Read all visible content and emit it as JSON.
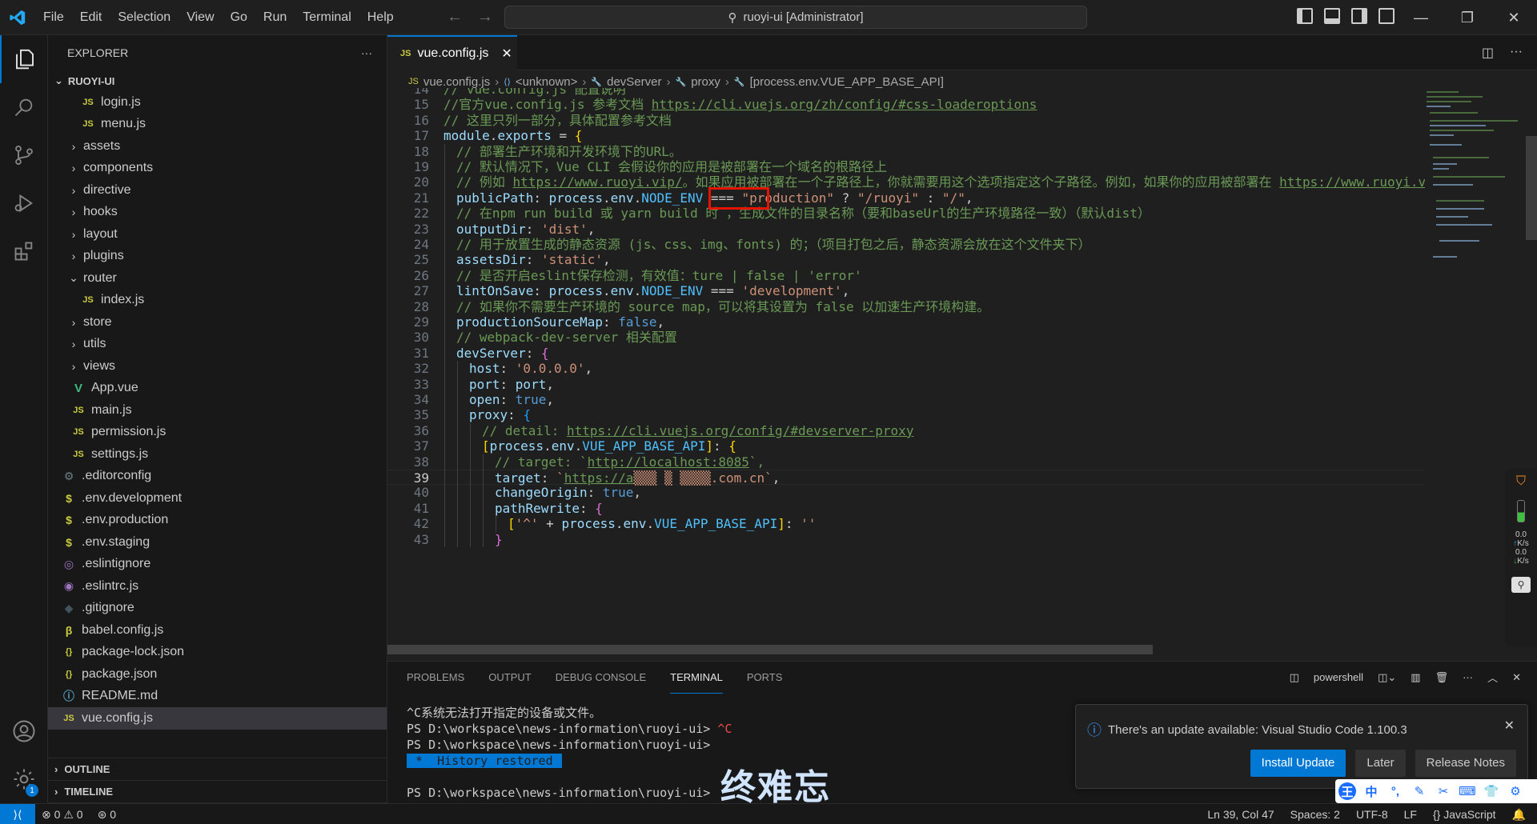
{
  "titlebar": {
    "menu": [
      "File",
      "Edit",
      "Selection",
      "View",
      "Go",
      "Run",
      "Terminal",
      "Help"
    ],
    "command_center": "ruoyi-ui [Administrator]"
  },
  "sidebar": {
    "header": "EXPLORER",
    "more": "···",
    "root": "RUOYI-UI",
    "items": [
      {
        "label": "login.js",
        "type": "file",
        "icon": "JS",
        "depth": 3
      },
      {
        "label": "menu.js",
        "type": "file",
        "icon": "JS",
        "depth": 3
      },
      {
        "label": "assets",
        "type": "folder",
        "depth": 2
      },
      {
        "label": "components",
        "type": "folder",
        "depth": 2
      },
      {
        "label": "directive",
        "type": "folder",
        "depth": 2
      },
      {
        "label": "hooks",
        "type": "folder",
        "depth": 2
      },
      {
        "label": "layout",
        "type": "folder",
        "depth": 2
      },
      {
        "label": "plugins",
        "type": "folder",
        "depth": 2
      },
      {
        "label": "router",
        "type": "folder-open",
        "depth": 2
      },
      {
        "label": "index.js",
        "type": "file",
        "icon": "JS",
        "depth": 3
      },
      {
        "label": "store",
        "type": "folder",
        "depth": 2
      },
      {
        "label": "utils",
        "type": "folder",
        "depth": 2
      },
      {
        "label": "views",
        "type": "folder",
        "depth": 2
      },
      {
        "label": "App.vue",
        "type": "file",
        "icon": "V",
        "depth": 2
      },
      {
        "label": "main.js",
        "type": "file",
        "icon": "JS",
        "depth": 2
      },
      {
        "label": "permission.js",
        "type": "file",
        "icon": "JS",
        "depth": 2
      },
      {
        "label": "settings.js",
        "type": "file",
        "icon": "JS",
        "depth": 2
      },
      {
        "label": ".editorconfig",
        "type": "file",
        "icon": "⚙",
        "depth": 1
      },
      {
        "label": ".env.development",
        "type": "file",
        "icon": "$",
        "depth": 1
      },
      {
        "label": ".env.production",
        "type": "file",
        "icon": "$",
        "depth": 1
      },
      {
        "label": ".env.staging",
        "type": "file",
        "icon": "$",
        "depth": 1
      },
      {
        "label": ".eslintignore",
        "type": "file",
        "icon": "◎",
        "depth": 1
      },
      {
        "label": ".eslintrc.js",
        "type": "file",
        "icon": "◉",
        "depth": 1
      },
      {
        "label": ".gitignore",
        "type": "file",
        "icon": "◆",
        "depth": 1
      },
      {
        "label": "babel.config.js",
        "type": "file",
        "icon": "β",
        "depth": 1
      },
      {
        "label": "package-lock.json",
        "type": "file",
        "icon": "{}",
        "depth": 1
      },
      {
        "label": "package.json",
        "type": "file",
        "icon": "{}",
        "depth": 1
      },
      {
        "label": "README.md",
        "type": "file",
        "icon": "ⓘ",
        "depth": 1
      },
      {
        "label": "vue.config.js",
        "type": "file",
        "icon": "JS",
        "depth": 1,
        "selected": true
      }
    ],
    "outline": "OUTLINE",
    "timeline": "TIMELINE"
  },
  "editor": {
    "tab_label": "vue.config.js",
    "tab_icon": "JS",
    "breadcrumb": [
      "vue.config.js",
      "<unknown>",
      "devServer",
      "proxy",
      "[process.env.VUE_APP_BASE_API]"
    ],
    "current_line": 39,
    "lines": [
      {
        "n": 14,
        "indent": 0,
        "parts": [
          [
            "c-com",
            "// vue.config.js 配置说明"
          ]
        ]
      },
      {
        "n": 15,
        "indent": 0,
        "parts": [
          [
            "c-com",
            "//官方vue.config.js 参考文档 "
          ],
          [
            "c-link",
            "https://cli.vuejs.org/zh/config/#css-loaderoptions"
          ]
        ]
      },
      {
        "n": 16,
        "indent": 0,
        "parts": [
          [
            "c-com",
            "// 这里只列一部分，具体配置参考文档"
          ]
        ]
      },
      {
        "n": 17,
        "indent": 0,
        "parts": [
          [
            "c-var",
            "module"
          ],
          [
            "c-p",
            "."
          ],
          [
            "c-var",
            "exports"
          ],
          [
            "c-p",
            " = "
          ],
          [
            "c-y",
            "{"
          ]
        ]
      },
      {
        "n": 18,
        "indent": 1,
        "parts": [
          [
            "c-com",
            "// 部署生产环境和开发环境下的URL。"
          ]
        ]
      },
      {
        "n": 19,
        "indent": 1,
        "parts": [
          [
            "c-com",
            "// 默认情况下，Vue CLI 会假设你的应用是被部署在一个域名的根路径上"
          ]
        ]
      },
      {
        "n": 20,
        "indent": 1,
        "parts": [
          [
            "c-com",
            "// 例如 "
          ],
          [
            "c-link",
            "https://www.ruoyi.vip/"
          ],
          [
            "c-com",
            "。如果应用被部署在一个子路径上，你就需要用这个选项指定这个子路径。例如，如果你的应用被部署在 "
          ],
          [
            "c-link",
            "https://www.ruoyi.vip/admin/"
          ]
        ]
      },
      {
        "n": 21,
        "indent": 1,
        "parts": [
          [
            "c-var",
            "publicPath"
          ],
          [
            "c-p",
            ": "
          ],
          [
            "c-var",
            "process"
          ],
          [
            "c-p",
            "."
          ],
          [
            "c-var",
            "env"
          ],
          [
            "c-p",
            "."
          ],
          [
            "c-const",
            "NODE_ENV"
          ],
          [
            "c-p",
            " === "
          ],
          [
            "c-str",
            "\"production\""
          ],
          [
            "c-p",
            " ? "
          ],
          [
            "c-str",
            "\"/ruoyi\""
          ],
          [
            "c-p",
            " : "
          ],
          [
            "c-str",
            "\"/\""
          ],
          [
            "c-p",
            ","
          ]
        ]
      },
      {
        "n": 22,
        "indent": 1,
        "parts": [
          [
            "c-com",
            "// 在npm run build 或 yarn build 时 ，生成文件的目录名称（要和baseUrl的生产环境路径一致）（默认dist）"
          ]
        ]
      },
      {
        "n": 23,
        "indent": 1,
        "parts": [
          [
            "c-var",
            "outputDir"
          ],
          [
            "c-p",
            ": "
          ],
          [
            "c-str",
            "'dist'"
          ],
          [
            "c-p",
            ","
          ]
        ]
      },
      {
        "n": 24,
        "indent": 1,
        "parts": [
          [
            "c-com",
            "// 用于放置生成的静态资源 (js、css、img、fonts) 的；（项目打包之后，静态资源会放在这个文件夹下）"
          ]
        ]
      },
      {
        "n": 25,
        "indent": 1,
        "parts": [
          [
            "c-var",
            "assetsDir"
          ],
          [
            "c-p",
            ": "
          ],
          [
            "c-str",
            "'static'"
          ],
          [
            "c-p",
            ","
          ]
        ]
      },
      {
        "n": 26,
        "indent": 1,
        "parts": [
          [
            "c-com",
            "// 是否开启eslint保存检测，有效值：ture | false | 'error'"
          ]
        ]
      },
      {
        "n": 27,
        "indent": 1,
        "parts": [
          [
            "c-var",
            "lintOnSave"
          ],
          [
            "c-p",
            ": "
          ],
          [
            "c-var",
            "process"
          ],
          [
            "c-p",
            "."
          ],
          [
            "c-var",
            "env"
          ],
          [
            "c-p",
            "."
          ],
          [
            "c-const",
            "NODE_ENV"
          ],
          [
            "c-p",
            " === "
          ],
          [
            "c-str",
            "'development'"
          ],
          [
            "c-p",
            ","
          ]
        ]
      },
      {
        "n": 28,
        "indent": 1,
        "parts": [
          [
            "c-com",
            "// 如果你不需要生产环境的 source map，可以将其设置为 false 以加速生产环境构建。"
          ]
        ]
      },
      {
        "n": 29,
        "indent": 1,
        "parts": [
          [
            "c-var",
            "productionSourceMap"
          ],
          [
            "c-p",
            ": "
          ],
          [
            "c-kw",
            "false"
          ],
          [
            "c-p",
            ","
          ]
        ]
      },
      {
        "n": 30,
        "indent": 1,
        "parts": [
          [
            "c-com",
            "// webpack-dev-server 相关配置"
          ]
        ]
      },
      {
        "n": 31,
        "indent": 1,
        "parts": [
          [
            "c-var",
            "devServer"
          ],
          [
            "c-p",
            ": "
          ],
          [
            "c-pk",
            "{"
          ]
        ]
      },
      {
        "n": 32,
        "indent": 2,
        "parts": [
          [
            "c-var",
            "host"
          ],
          [
            "c-p",
            ": "
          ],
          [
            "c-str",
            "'0.0.0.0'"
          ],
          [
            "c-p",
            ","
          ]
        ]
      },
      {
        "n": 33,
        "indent": 2,
        "parts": [
          [
            "c-var",
            "port"
          ],
          [
            "c-p",
            ": "
          ],
          [
            "c-var",
            "port"
          ],
          [
            "c-p",
            ","
          ]
        ]
      },
      {
        "n": 34,
        "indent": 2,
        "parts": [
          [
            "c-var",
            "open"
          ],
          [
            "c-p",
            ": "
          ],
          [
            "c-kw",
            "true"
          ],
          [
            "c-p",
            ","
          ]
        ]
      },
      {
        "n": 35,
        "indent": 2,
        "parts": [
          [
            "c-var",
            "proxy"
          ],
          [
            "c-p",
            ": "
          ],
          [
            "c-bl",
            "{"
          ]
        ]
      },
      {
        "n": 36,
        "indent": 3,
        "parts": [
          [
            "c-com",
            "// detail: "
          ],
          [
            "c-link",
            "https://cli.vuejs.org/config/#devserver-proxy"
          ]
        ]
      },
      {
        "n": 37,
        "indent": 3,
        "parts": [
          [
            "c-y",
            "["
          ],
          [
            "c-var",
            "process"
          ],
          [
            "c-p",
            "."
          ],
          [
            "c-var",
            "env"
          ],
          [
            "c-p",
            "."
          ],
          [
            "c-const",
            "VUE_APP_BASE_API"
          ],
          [
            "c-y",
            "]"
          ],
          [
            "c-p",
            ": "
          ],
          [
            "c-y",
            "{"
          ]
        ]
      },
      {
        "n": 38,
        "indent": 4,
        "parts": [
          [
            "c-com",
            "// target: `"
          ],
          [
            "c-link",
            "http://localhost:8085"
          ],
          [
            "c-com",
            "`,"
          ]
        ]
      },
      {
        "n": 39,
        "indent": 4,
        "parts": [
          [
            "c-var",
            "target"
          ],
          [
            "c-p",
            ": "
          ],
          [
            "c-str",
            "`"
          ],
          [
            "c-link",
            "https://a"
          ],
          [
            "c-str",
            "▒▒▒ ▒ ▒▒▒▒"
          ],
          [
            "c-str",
            ".com.cn`"
          ],
          [
            "c-p",
            ","
          ]
        ]
      },
      {
        "n": 40,
        "indent": 4,
        "parts": [
          [
            "c-var",
            "changeOrigin"
          ],
          [
            "c-p",
            ": "
          ],
          [
            "c-kw",
            "true"
          ],
          [
            "c-p",
            ","
          ]
        ]
      },
      {
        "n": 41,
        "indent": 4,
        "parts": [
          [
            "c-var",
            "pathRewrite"
          ],
          [
            "c-p",
            ": "
          ],
          [
            "c-pk",
            "{"
          ]
        ]
      },
      {
        "n": 42,
        "indent": 5,
        "parts": [
          [
            "c-y",
            "["
          ],
          [
            "c-str",
            "'^'"
          ],
          [
            "c-p",
            " + "
          ],
          [
            "c-var",
            "process"
          ],
          [
            "c-p",
            "."
          ],
          [
            "c-var",
            "env"
          ],
          [
            "c-p",
            "."
          ],
          [
            "c-const",
            "VUE_APP_BASE_API"
          ],
          [
            "c-y",
            "]"
          ],
          [
            "c-p",
            ": "
          ],
          [
            "c-str",
            "''"
          ]
        ]
      },
      {
        "n": 43,
        "indent": 4,
        "parts": [
          [
            "c-pk",
            "}"
          ]
        ]
      }
    ]
  },
  "panel": {
    "tabs": [
      "PROBLEMS",
      "OUTPUT",
      "DEBUG CONSOLE",
      "TERMINAL",
      "PORTS"
    ],
    "active_tab": "TERMINAL",
    "shell": "powershell",
    "terminal_lines": [
      "^C系统无法打开指定的设备或文件。",
      "PS D:\\workspace\\news-information\\ruoyi-ui> ^C",
      "PS D:\\workspace\\news-information\\ruoyi-ui>",
      " *  History restored ",
      "",
      "PS D:\\workspace\\news-information\\ruoyi-ui>"
    ],
    "handwritten": "终难忘"
  },
  "notification": {
    "message": "There's an update available: Visual Studio Code 1.100.3",
    "install": "Install Update",
    "later": "Later",
    "release_notes": "Release Notes"
  },
  "statusbar": {
    "errors": "0",
    "warnings": "0",
    "ports": "0",
    "position": "Ln 39, Col 47",
    "spaces": "Spaces: 2",
    "encoding": "UTF-8",
    "eol": "LF",
    "language": "JavaScript"
  },
  "network_widget": {
    "up": "0.0",
    "up_unit": "K/s",
    "down": "0.0",
    "down_unit": "K/s"
  },
  "ime": [
    "王",
    "中",
    "°,",
    "✎",
    "✂",
    "⌨",
    "👕",
    "⚙"
  ],
  "colors": {
    "accent": "#0078d4",
    "editor_bg": "#1f1f1f",
    "sidebar_bg": "#181818",
    "highlight_box": "#e51400"
  }
}
